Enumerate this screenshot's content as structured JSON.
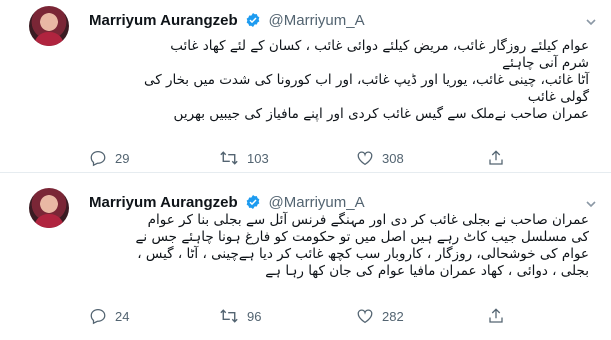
{
  "colors": {
    "verified": "#1d9bf0",
    "icon": "#536471",
    "divider": "#e6ecf0"
  },
  "tweets": [
    {
      "author_name": "Marriyum Aurangzeb",
      "handle": "@Marriyum_A",
      "verified_icon": "verified-badge-icon",
      "lines": [
        "عوام کیلئے روزگار غائب، مریض کیلئے دوائی غائب ، کسان کے لئے کھاد غائب",
        "شرم آنی چاہئے",
        "آٹا غائب، چینی غائب، یوریا اور ڈیپ غائب، اور اب کورونا کی شدت میں بخار کی",
        "گولی غائب",
        "عمران صاحب نےملک سے گیس غائب کردی اور اپنے مافیاز کی جیبیں بھریں"
      ],
      "replies": "29",
      "retweets": "103",
      "likes": "308"
    },
    {
      "author_name": "Marriyum Aurangzeb",
      "handle": "@Marriyum_A",
      "verified_icon": "verified-badge-icon",
      "lines": [
        "عمران صاحب نے بجلی غائب کر دی اور مہنگے فرنس آئل سے بجلی بنا کر عوام",
        "کی مسلسل جیب کاٹ رہے ہیں اصل میں تو حکومت کو فارغ ہونا چاہئے جس نے",
        "عوام کی خوشحالی، روزگار ، کاروبار سب کچھ غائب کر دیا ہےچینی ، آٹا ، گیس ،",
        "بجلی ، دوائی ، کھاد عمران مافیا عوام کی جان کھا رہا ہے"
      ],
      "replies": "24",
      "retweets": "96",
      "likes": "282"
    }
  ]
}
